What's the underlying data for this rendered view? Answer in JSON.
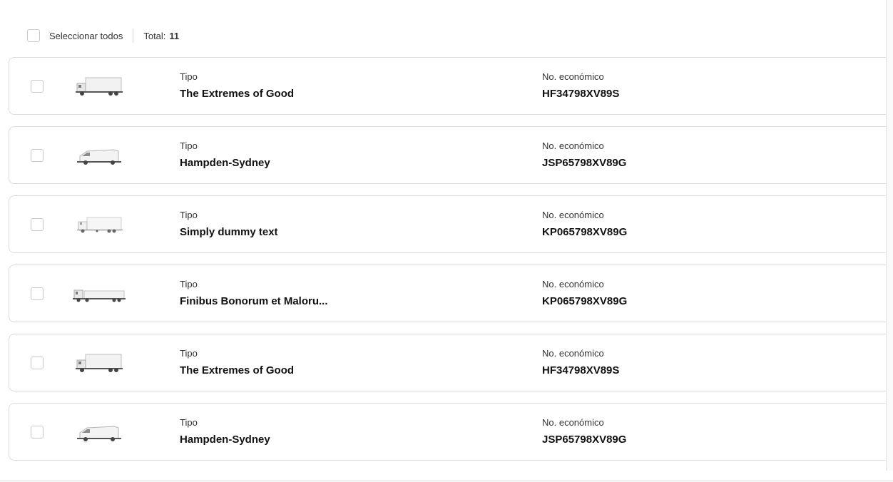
{
  "toolbar": {
    "select_all_label": "Seleccionar todos",
    "total_label": "Total:",
    "total_value": "11"
  },
  "labels": {
    "tipo": "Tipo",
    "economic_number": "No. económico"
  },
  "vehicles": [
    {
      "icon": "box-truck-icon",
      "tipo": "The Extremes of Good",
      "economic_number": "HF34798XV89S"
    },
    {
      "icon": "van-icon",
      "tipo": "Hampden-Sydney",
      "economic_number": "JSP65798XV89G"
    },
    {
      "icon": "box-truck-icon",
      "tipo": "Simply dummy text",
      "economic_number": "KP065798XV89G"
    },
    {
      "icon": "trailer-truck-icon",
      "tipo": "Finibus Bonorum et Maloru...",
      "economic_number": "KP065798XV89G"
    },
    {
      "icon": "box-truck-icon",
      "tipo": "The Extremes of Good",
      "economic_number": "HF34798XV89S"
    },
    {
      "icon": "van-icon",
      "tipo": "Hampden-Sydney",
      "economic_number": "JSP65798XV89G"
    }
  ],
  "colors": {
    "border": "#dcdcdc",
    "text": "#111111"
  }
}
